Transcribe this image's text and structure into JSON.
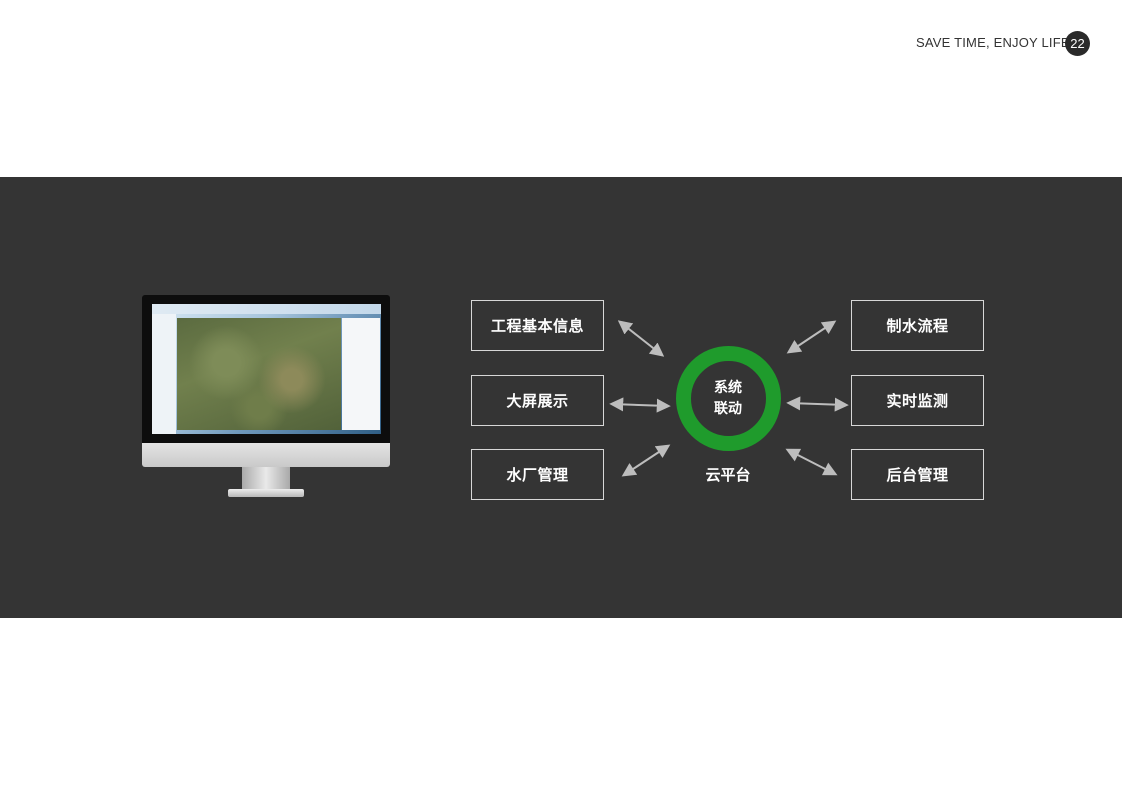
{
  "header": {
    "tagline": "SAVE TIME, ENJOY LIFE",
    "page_number": "22"
  },
  "hub": {
    "line1": "系统",
    "line2": "联动",
    "caption": "云平台",
    "ring_color": "#1f9b2c"
  },
  "modules": {
    "left": [
      "工程基本信息",
      "大屏展示",
      "水厂管理"
    ],
    "right": [
      "制水流程",
      "实时监测",
      "后台管理"
    ]
  },
  "colors": {
    "band": "#343434",
    "arrow": "#bdbdbd",
    "box_border": "#d7d7d7"
  }
}
